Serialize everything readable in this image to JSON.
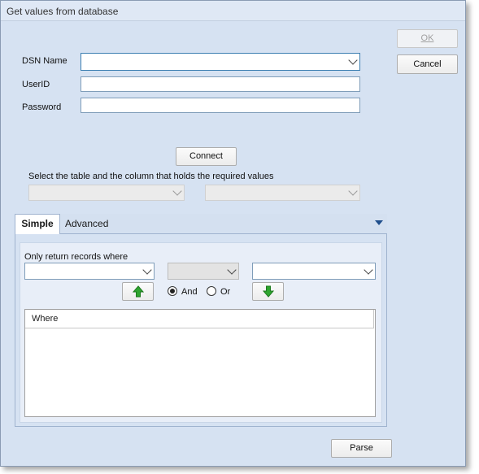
{
  "window": {
    "title": "Get values from database"
  },
  "buttons": {
    "ok": "OK",
    "cancel": "Cancel",
    "connect": "Connect",
    "parse": "Parse"
  },
  "form": {
    "dsn_label": "DSN Name",
    "userid_label": "UserID",
    "password_label": "Password",
    "dsn_value": "",
    "userid_value": "",
    "password_value": ""
  },
  "table_select": {
    "label": "Select the table and the column that holds the required values"
  },
  "tabs": {
    "simple": "Simple",
    "advanced": "Advanced"
  },
  "simple": {
    "filter_label": "Only return records where",
    "and_label": "And",
    "or_label": "Or",
    "selected_logic": "And",
    "where_header": "Where"
  },
  "icons": {
    "up": "arrow-up-icon",
    "down": "arrow-down-icon",
    "accent_green": "#2fa52f"
  }
}
